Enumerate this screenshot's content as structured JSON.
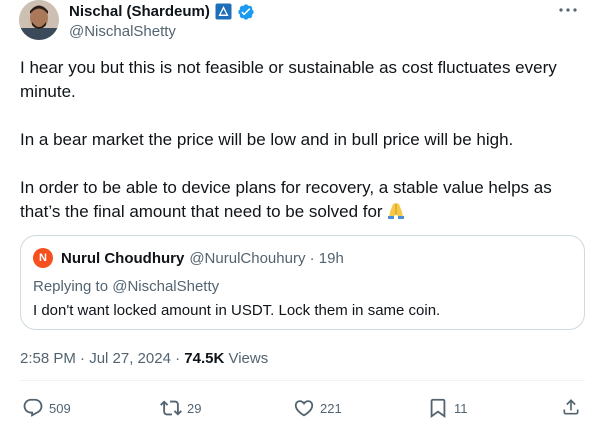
{
  "author": {
    "display_name": "Nischal (Shardeum)",
    "handle": "@NischalShetty"
  },
  "body": {
    "paragraphs": [
      "I hear you but this is not feasible or sustainable as cost fluctuates every minute.",
      "In a bear market the price will be low and in bull price will be high.",
      "In order to be able to device plans for recovery, a stable value helps as that’s the final amount that need to be solved for"
    ]
  },
  "quote": {
    "avatar_letter": "N",
    "display_name": "Nurul Choudhury",
    "handle_time": "@NurulChouhury · 19h",
    "replying_to": "Replying to @NischalShetty",
    "text": "I don't want locked amount in USDT. Lock them in same coin."
  },
  "meta": {
    "timestamp": "2:58 PM · Jul 27, 2024 · ",
    "views_count": "74.5K",
    "views_label": " Views"
  },
  "actions": {
    "replies": "509",
    "reposts": "29",
    "likes": "221",
    "bookmarks": "11"
  },
  "colors": {
    "text": "#0f1419",
    "secondary": "#536471",
    "verified": "#1d9bf0",
    "border": "#cfd9de",
    "quote_avatar": "#f4511e"
  }
}
